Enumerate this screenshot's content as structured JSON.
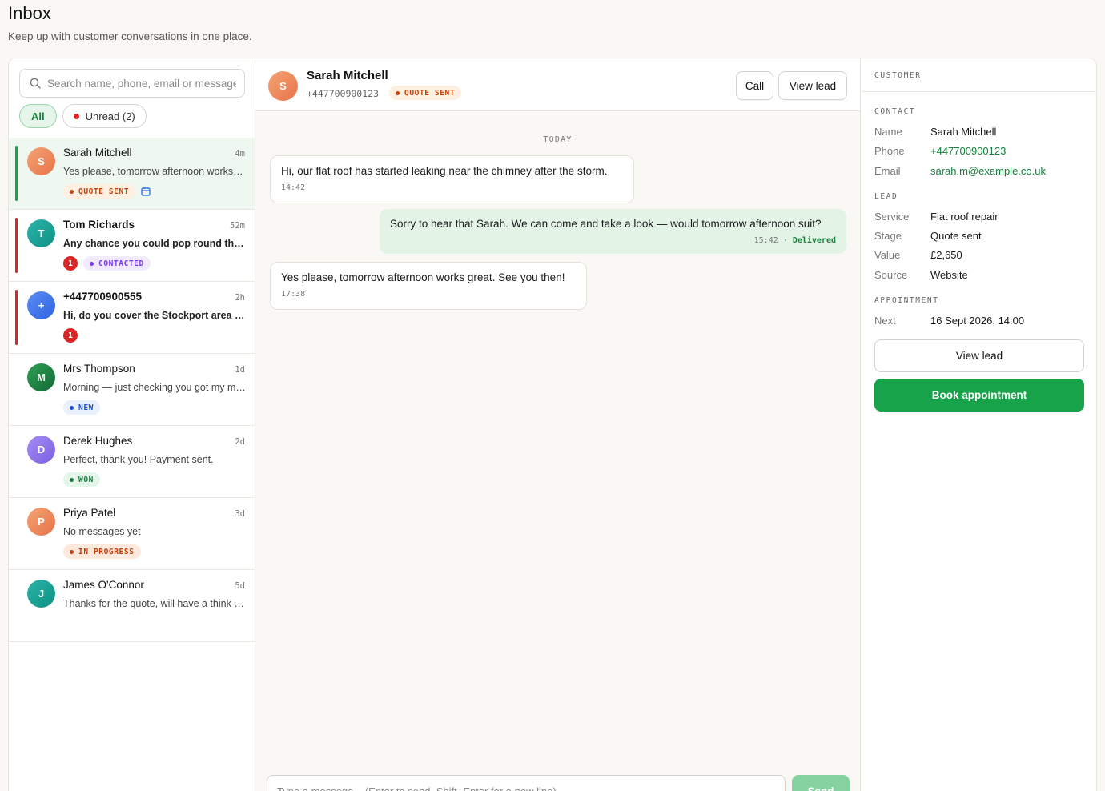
{
  "header": {
    "title": "Inbox",
    "subtitle": "Keep up with customer conversations in one place."
  },
  "search": {
    "placeholder": "Search name, phone, email or message"
  },
  "filters": {
    "all": "All",
    "unread": "Unread (2)"
  },
  "threads": [
    {
      "initial": "S",
      "name": "Sarah Mitchell",
      "time": "4m",
      "preview": "Yes please, tomorrow afternoon works great. See you then!",
      "tag": "QUOTE SENT"
    },
    {
      "initial": "T",
      "name": "Tom Richards",
      "time": "52m",
      "preview": "Any chance you could pop round this week to have a look?",
      "unread": "1",
      "tag": "CONTACTED"
    },
    {
      "initial": "+",
      "name": "+447700900555",
      "time": "2h",
      "preview": "Hi, do you cover the Stockport area for roof repairs?",
      "unread": "1"
    },
    {
      "initial": "M",
      "name": "Mrs Thompson",
      "time": "1d",
      "preview": "Morning — just checking you got my message about the gutters",
      "tag": "NEW"
    },
    {
      "initial": "D",
      "name": "Derek Hughes",
      "time": "2d",
      "preview": "Perfect, thank you! Payment sent.",
      "tag": "WON"
    },
    {
      "initial": "P",
      "name": "Priya Patel",
      "time": "3d",
      "preview": "No messages yet",
      "tag": "IN PROGRESS"
    },
    {
      "initial": "J",
      "name": "James O'Connor",
      "time": "5d",
      "preview": "Thanks for the quote, will have a think and get back to you"
    }
  ],
  "chat": {
    "initial": "S",
    "name": "Sarah Mitchell",
    "phone": "+447700900123",
    "tag": "QUOTE SENT",
    "call_label": "Call",
    "view_lead_label": "View lead",
    "day_label": "TODAY",
    "messages": [
      {
        "direction": "in",
        "text": "Hi, our flat roof has started leaking near the chimney after the storm.",
        "time": "14:42"
      },
      {
        "direction": "out",
        "text": "Sorry to hear that Sarah. We can come and take a look — would tomorrow afternoon suit?",
        "time": "15:42",
        "status": "Delivered"
      },
      {
        "direction": "in",
        "text": "Yes please, tomorrow afternoon works great. See you then!",
        "time": "17:38"
      }
    ],
    "composer_placeholder": "Type a message... (Enter to send, Shift+Enter for a new line)",
    "send_label": "Send"
  },
  "panel": {
    "title": "CUSTOMER",
    "contact_heading": "CONTACT",
    "contact": [
      {
        "k": "Name",
        "v": "Sarah Mitchell"
      },
      {
        "k": "Phone",
        "v": "+447700900123"
      },
      {
        "k": "Email",
        "v": "sarah.m@example.co.uk"
      }
    ],
    "lead_heading": "LEAD",
    "lead": [
      {
        "k": "Service",
        "v": "Flat roof repair"
      },
      {
        "k": "Stage",
        "v": "Quote sent"
      },
      {
        "k": "Value",
        "v": "£2,650"
      },
      {
        "k": "Source",
        "v": "Website"
      }
    ],
    "appointment_heading": "APPOINTMENT",
    "appointment": [
      {
        "k": "Next",
        "v": "16 Sept 2026, 14:00"
      }
    ],
    "view_lead_label": "View lead",
    "book_label": "Book appointment"
  },
  "colors": {
    "accent": "#16a34a",
    "unread_red": "#dc2626",
    "quote_sent": "#c2410c",
    "contacted": "#7c3aed",
    "new": "#1d4ed8",
    "won": "#15803d"
  }
}
